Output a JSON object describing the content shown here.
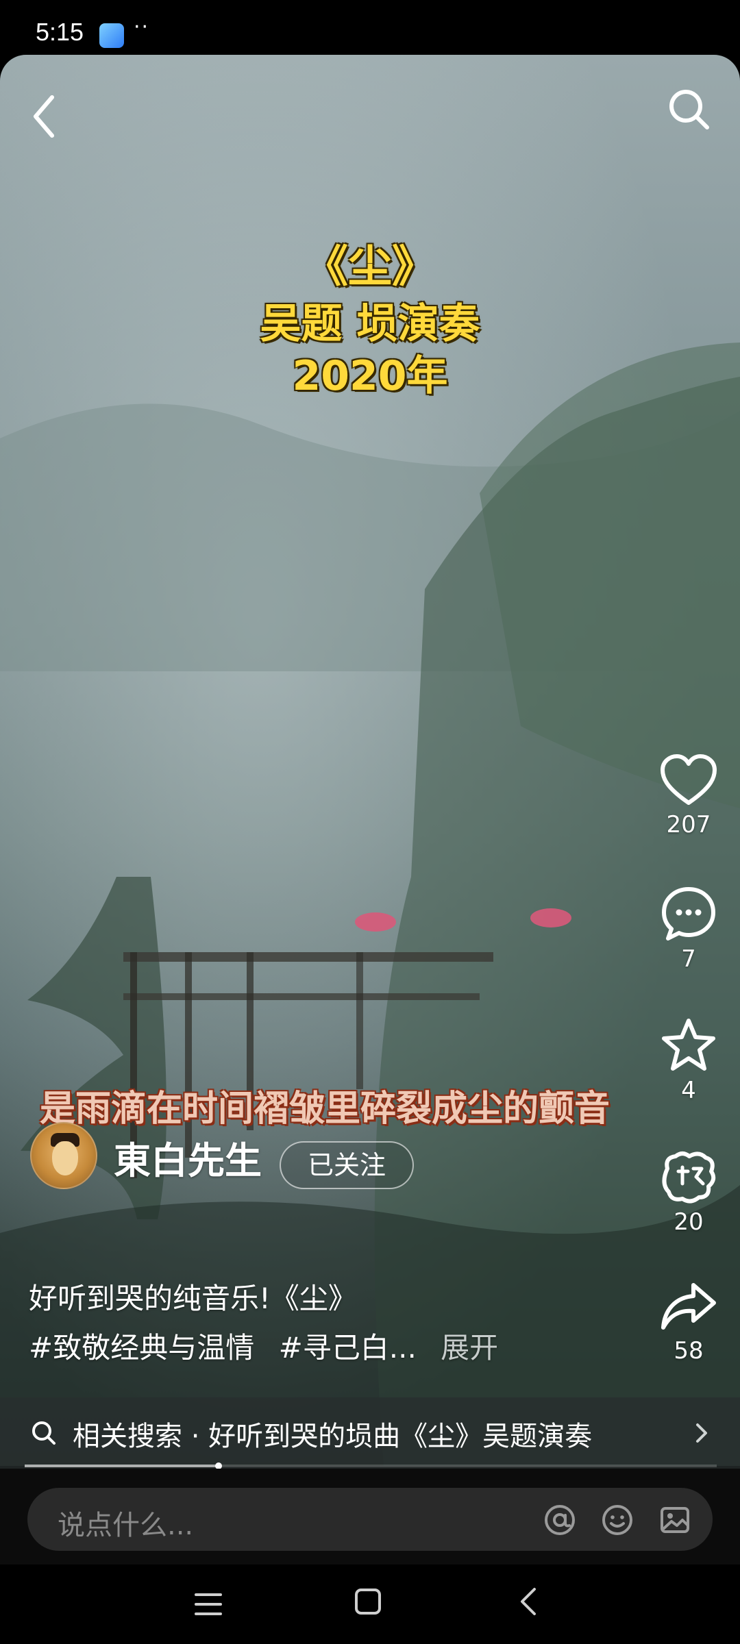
{
  "status_bar": {
    "time": "5:15",
    "dots": "··"
  },
  "video": {
    "title_lines": [
      "《尘》",
      "吴题 埙演奏",
      "2020年"
    ],
    "subtitle": "是雨滴在时间褶皱里碎裂成尘的颤音"
  },
  "actions": {
    "like_count": "207",
    "comment_count": "7",
    "favorite_count": "4",
    "hug_count": "20",
    "share_count": "58"
  },
  "author": {
    "name": "東白先生",
    "follow_label": "已关注"
  },
  "caption": "好听到哭的纯音乐!《尘》",
  "tags": [
    "#致敬经典与温情",
    "#寻己白..."
  ],
  "expand_label": "展开",
  "related_search": {
    "text": "相关搜索 · 好听到哭的埙曲《尘》吴题演奏"
  },
  "progress": {
    "played_fraction": 0.28
  },
  "comment_bar": {
    "placeholder": "说点什么..."
  },
  "icons": {
    "back": "back-arrow-icon",
    "search": "search-icon",
    "like": "heart-icon",
    "comment": "comment-bubble-icon",
    "favorite": "star-icon",
    "hug": "hug-icon",
    "share": "share-arrow-icon",
    "at": "at-icon",
    "emoji": "emoji-icon",
    "image": "image-icon"
  },
  "colors": {
    "title_yellow": "#ffd93b",
    "subtitle_text": "#f0c9b5",
    "subtitle_outline": "#8a2d15"
  }
}
